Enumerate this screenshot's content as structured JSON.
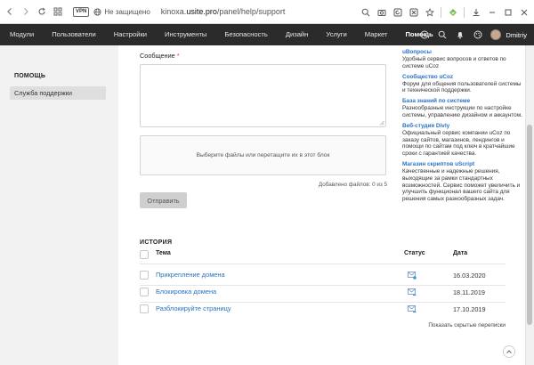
{
  "browser": {
    "vpn_label": "VPN",
    "security_text": "Не защищено",
    "url_host": "kinoxa.",
    "url_domain": "usite.pro",
    "url_path": "/panel/help/support"
  },
  "topnav": {
    "items": [
      "Модули",
      "Пользователи",
      "Настройки",
      "Инструменты",
      "Безопасность",
      "Дизайн",
      "Услуги",
      "Маркет",
      "Помощь"
    ],
    "active_item": "Помощь",
    "username": "Dmitriy"
  },
  "sidebar": {
    "title": "ПОМОЩЬ",
    "items": [
      {
        "label": "Служба поддержки"
      }
    ]
  },
  "form": {
    "message_label": "Сообщение",
    "required_mark": "*",
    "dropzone_text": "Выберите файлы или перетащите их в этот блок",
    "files_added": "Добавлено файлов: 0 из 5",
    "send_label": "Отправить"
  },
  "info": [
    {
      "title": "uВопросы",
      "desc": "Удобный сервис вопросов и ответов по системе uCoz"
    },
    {
      "title": "Сообщество uCoz",
      "desc": "Форум для общения пользователей системы и технической поддержки."
    },
    {
      "title": "База знаний по системе",
      "desc": "Разнообразные инструкции по настройке системы, управлению дизайном и аккаунтом."
    },
    {
      "title": "Веб-студия Divly",
      "desc": "Официальный сервис компании uCoz по заказу сайтов, магазинов, лендингов и помощи по сайтам под ключ в кратчайшие сроки с гарантией качества."
    },
    {
      "title": "Магазин скриптов uScript",
      "desc": "Качественные и надежные решения, выходящие за рамки стандартных возможностей. Сервис поможет увеличить и улучшить функционал вашего сайта для решения самых разнообразных задач."
    }
  ],
  "history": {
    "title": "ИСТОРИЯ",
    "columns": {
      "subject": "Тема",
      "status": "Статус",
      "date": "Дата"
    },
    "rows": [
      {
        "subject": "Прикрепление домена",
        "date": "16.03.2020",
        "status_icon": "ticket-read-icon"
      },
      {
        "subject": "Блокировка домена",
        "date": "18.11.2019",
        "status_icon": "ticket-replied-icon"
      },
      {
        "subject": "Разблокируйте страницу",
        "date": "17.10.2019",
        "status_icon": "ticket-replied-icon"
      }
    ],
    "show_hidden": "Показать скрытые переписки"
  },
  "colors": {
    "accent": "#2a72c4",
    "nav_bg": "#2b2b2b",
    "required": "#e04040"
  }
}
